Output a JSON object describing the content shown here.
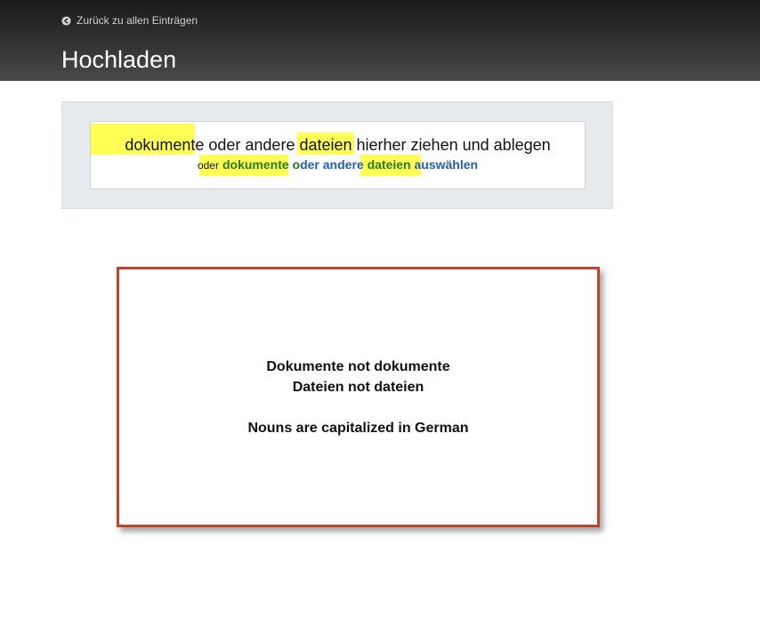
{
  "header": {
    "back_link": "Zurück zu allen Einträgen",
    "title": "Hochladen"
  },
  "upload": {
    "drop_word1": "dokumente",
    "drop_mid1": " oder andere ",
    "drop_word2": "dateien",
    "drop_rest": " hierher ziehen und ablegen",
    "or_label": "oder",
    "link_part1": "dokumente o",
    "link_part2": "der andere ",
    "link_part3": "dateien",
    "link_part4": " auswählen"
  },
  "annotation": {
    "line1": "Dokumente not dokumente",
    "line2": "Dateien not dateien",
    "line3": "Nouns are capitalized in German",
    "border_color": "#c0432b"
  },
  "colors": {
    "highlight": "#ffff55",
    "link_blue": "#1f5fb4",
    "link_green": "#2a7a1e"
  }
}
